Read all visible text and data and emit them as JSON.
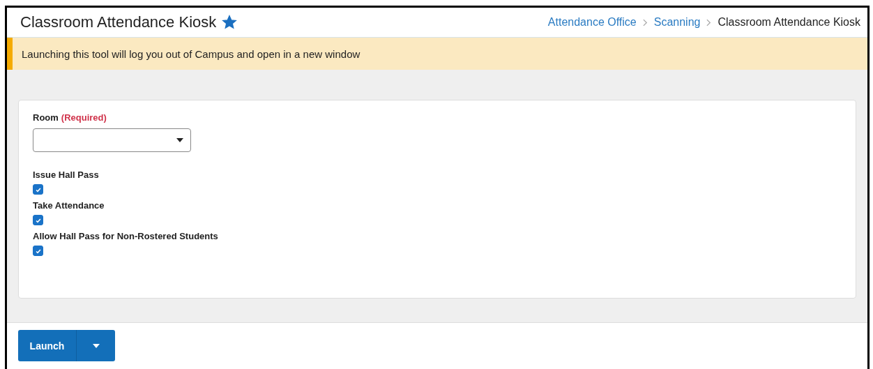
{
  "header": {
    "title": "Classroom Attendance Kiosk",
    "favorite": true,
    "breadcrumbs": [
      {
        "label": "Attendance Office",
        "link": true
      },
      {
        "label": "Scanning",
        "link": true
      },
      {
        "label": "Classroom Attendance Kiosk",
        "link": false
      }
    ]
  },
  "banner": {
    "message": "Launching this tool will log you out of Campus and open in a new window"
  },
  "form": {
    "room": {
      "label": "Room",
      "required_note": "(Required)"
    },
    "options": [
      {
        "label": "Issue Hall Pass",
        "checked": true
      },
      {
        "label": "Take Attendance",
        "checked": true
      },
      {
        "label": "Allow Hall Pass for Non-Rostered Students",
        "checked": true
      }
    ]
  },
  "footer": {
    "launch_button": "Launch"
  }
}
